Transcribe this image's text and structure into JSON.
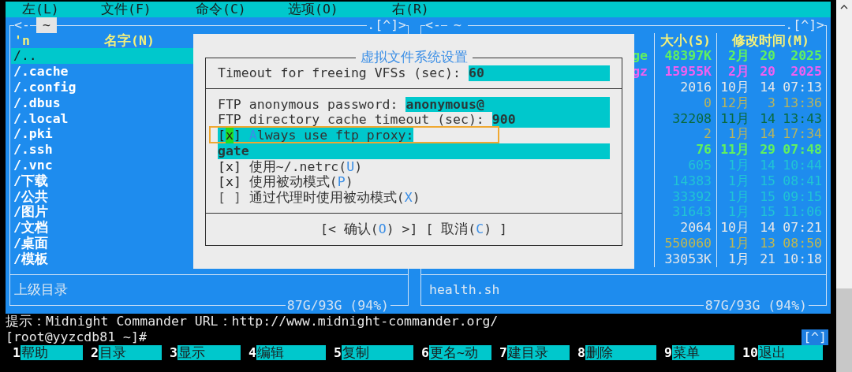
{
  "menu": [
    {
      "label": "左(L)"
    },
    {
      "label": "文件(F)"
    },
    {
      "label": "命令(C)"
    },
    {
      "label": "选项(O)"
    },
    {
      "label": "右(R)"
    }
  ],
  "left_panel": {
    "active": true,
    "nav_left": "<-",
    "path": "~",
    "nav_right": ".[^]>",
    "sort_indicator": "'n",
    "name_header": "名字(N)",
    "rows": [
      {
        "name": "/..",
        "selected": true
      },
      {
        "name": "/.cache",
        "selected": false
      },
      {
        "name": "/.config",
        "selected": false
      },
      {
        "name": "/.dbus",
        "selected": false
      },
      {
        "name": "/.local",
        "selected": false
      },
      {
        "name": "/.pki",
        "selected": false
      },
      {
        "name": "/.ssh",
        "selected": false
      },
      {
        "name": "/.vnc",
        "selected": false
      },
      {
        "name": "/下载",
        "selected": false
      },
      {
        "name": "/公共",
        "selected": false
      },
      {
        "name": "/图片",
        "selected": false
      },
      {
        "name": "/文档",
        "selected": false
      },
      {
        "name": "/桌面",
        "selected": false
      },
      {
        "name": "/模板",
        "selected": false
      }
    ],
    "mini_status": "上级目录",
    "free_space": "87G/93G (94%)"
  },
  "right_panel": {
    "active": false,
    "nav_left": "<-",
    "path": "~",
    "nav_right": ".[^]>",
    "size_header": "大小(S)",
    "time_header": "修改时间(M)",
    "rows": [
      {
        "name": "ge",
        "size": "48397K",
        "month": "2月",
        "day": "20",
        "time": "2025",
        "color": "#60f060",
        "bold": true
      },
      {
        "name": "gz",
        "size": "15955K",
        "month": "2月",
        "day": "20",
        "time": "2025",
        "color": "#f060f0",
        "bold": true
      },
      {
        "size": "2016",
        "month": "10月",
        "day": "14",
        "time": "07:13",
        "color": "#e8e8e8",
        "bold": false
      },
      {
        "size": "0",
        "month": "12月",
        "day": "3",
        "time": "13:36",
        "color": "#b8b45c",
        "bold": false
      },
      {
        "size": "32208",
        "month": "11月",
        "day": "14",
        "time": "13:43",
        "color": "#0a6a3c",
        "bold": false
      },
      {
        "size": "2",
        "month": "1月",
        "day": "14",
        "time": "17:34",
        "color": "#b8b45c",
        "bold": false
      },
      {
        "size": "76",
        "month": "11月",
        "day": "29",
        "time": "07:48",
        "color": "#60f060",
        "bold": true
      },
      {
        "size": "605",
        "month": "1月",
        "day": "14",
        "time": "10:44",
        "color": "#20c4d4",
        "bold": false
      },
      {
        "size": "14383",
        "month": "1月",
        "day": "15",
        "time": "08:41",
        "color": "#20c4d4",
        "bold": false
      },
      {
        "size": "33392",
        "month": "1月",
        "day": "15",
        "time": "09:15",
        "color": "#20c4d4",
        "bold": false
      },
      {
        "size": "31643",
        "month": "1月",
        "day": "15",
        "time": "11:06",
        "color": "#20c4d4",
        "bold": false
      },
      {
        "size": "2064",
        "month": "10月",
        "day": "14",
        "time": "07:21",
        "color": "#e8e8e8",
        "bold": false
      },
      {
        "size": "550060",
        "month": "1月",
        "day": "13",
        "time": "08:50",
        "color": "#c0b850",
        "bold": false
      },
      {
        "size": "33053K",
        "month": "1月",
        "day": "21",
        "time": "10:18",
        "color": "#e8e8e8",
        "bold": false
      }
    ],
    "mini_status": "health.sh",
    "free_space": "87G/93G (94%)"
  },
  "dialog": {
    "title": "虚拟文件系统设置",
    "sections": [
      {
        "items": [
          {
            "kind": "field",
            "label": "Timeout for freeing VFSs (sec):",
            "value": "60"
          }
        ]
      },
      {
        "items": [
          {
            "kind": "field",
            "label": "FTP anonymous password:",
            "value": "anonymous@"
          },
          {
            "kind": "field",
            "label": "FTP directory cache timeout (sec):",
            "value": "900"
          },
          {
            "kind": "checkbox",
            "box": "[x]",
            "checked": true,
            "focused": true,
            "annotated": true,
            "hotkey": "A",
            "label_after": "lways use ftp proxy:"
          },
          {
            "kind": "input",
            "value": "gate"
          },
          {
            "kind": "checkbox",
            "box": "[x]",
            "checked": true,
            "focused": false,
            "annotated": false,
            "label_before": "使用~/.netrc(",
            "hotkey": "U",
            "label_after": ")"
          },
          {
            "kind": "checkbox",
            "box": "[x]",
            "checked": true,
            "focused": false,
            "annotated": false,
            "label_before": "使用被动模式(",
            "hotkey": "P",
            "label_after": ")"
          },
          {
            "kind": "checkbox",
            "box": "[ ]",
            "checked": false,
            "focused": false,
            "annotated": false,
            "label_before": "通过代理时使用被动模式(",
            "hotkey": "X",
            "label_after": ")"
          }
        ]
      }
    ],
    "buttons": [
      {
        "label_before": "[< 确认(",
        "hotkey": "O",
        "label_after": ") >]"
      },
      {
        "label_before": "[ 取消(",
        "hotkey": "C",
        "label_after": ") ]"
      }
    ]
  },
  "hint": "提示：Midnight Commander URL：http://www.midnight-commander.org/",
  "prompt": "[root@yyzcdb81 ~]#",
  "history_button": "[^]",
  "keybar": [
    {
      "number": "1",
      "label": "帮助"
    },
    {
      "number": "2",
      "label": "目录"
    },
    {
      "number": "3",
      "label": "显示"
    },
    {
      "number": "4",
      "label": "编辑"
    },
    {
      "number": "5",
      "label": "复制"
    },
    {
      "number": "6",
      "label": "更名~动"
    },
    {
      "number": "7",
      "label": "建目录"
    },
    {
      "number": "8",
      "label": "删除"
    },
    {
      "number": "9",
      "label": "菜单"
    },
    {
      "number": "10",
      "label": "退出"
    }
  ]
}
